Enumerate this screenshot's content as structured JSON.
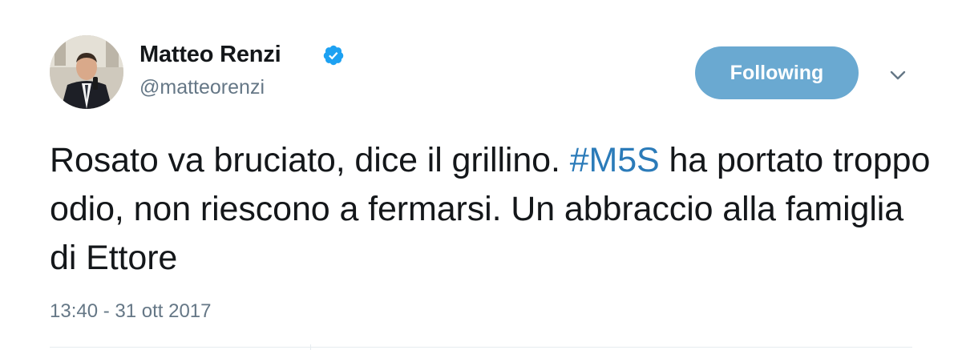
{
  "author": {
    "display_name": "Matteo Renzi",
    "handle": "@matteorenzi",
    "verified": true
  },
  "follow_button": {
    "label": "Following",
    "color": "#6aa9d1"
  },
  "menu": {
    "icon": "chevron-down-icon"
  },
  "tweet": {
    "text_part1": "Rosato va bruciato, dice il grillino. ",
    "hashtag": "#M5S",
    "text_part2": " ha portato troppo odio, non riescono a fermarsi. Un abbraccio alla famiglia di Ettore",
    "timestamp": "13:40 - 31 ott 2017"
  },
  "colors": {
    "text": "#14171a",
    "secondary": "#657786",
    "link": "#2b7bb9",
    "verified_badge": "#1da1f2"
  }
}
